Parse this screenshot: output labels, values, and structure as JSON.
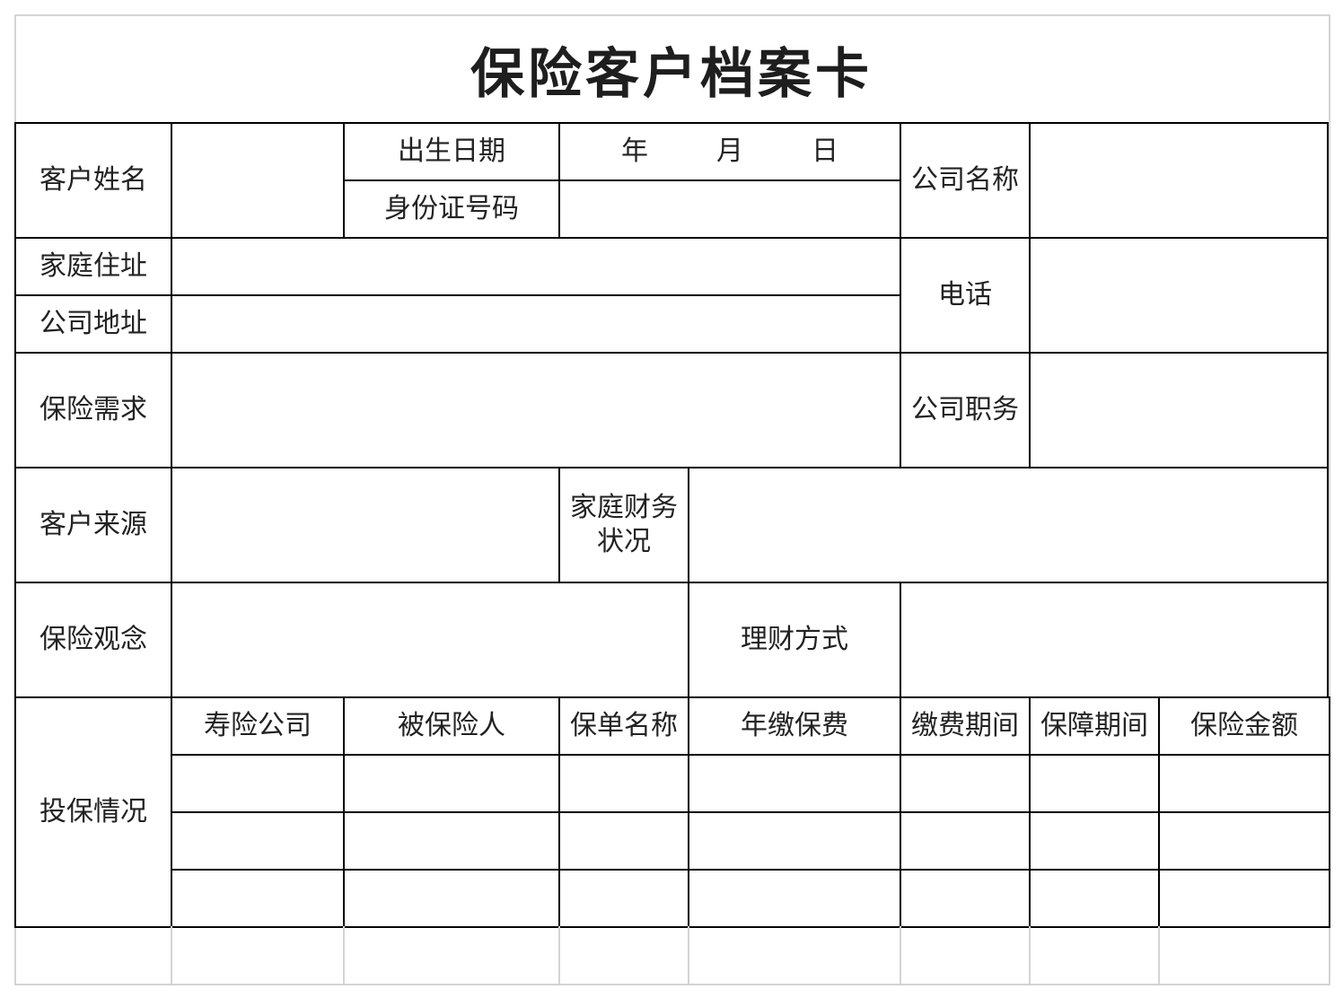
{
  "title": "保险客户档案卡",
  "labels": {
    "customer_name": "客户姓名",
    "birth_date": "出生日期",
    "id_number": "身份证号码",
    "company_name": "公司名称",
    "home_address": "家庭住址",
    "company_address": "公司地址",
    "phone": "电话",
    "insurance_needs": "保险需求",
    "company_position": "公司职务",
    "customer_source": "客户来源",
    "family_finance": "家庭财务状况",
    "insurance_concept": "保险观念",
    "financial_method": "理财方式",
    "policy_status": "投保情况"
  },
  "date_parts": {
    "year": "年",
    "month": "月",
    "day": "日"
  },
  "policy_table": {
    "headers": [
      "寿险公司",
      "被保险人",
      "保单名称",
      "年缴保费",
      "缴费期间",
      "保障期间",
      "保险金额"
    ],
    "rows": [
      [
        "",
        "",
        "",
        "",
        "",
        "",
        ""
      ],
      [
        "",
        "",
        "",
        "",
        "",
        "",
        ""
      ],
      [
        "",
        "",
        "",
        "",
        "",
        "",
        ""
      ]
    ]
  },
  "values": {
    "customer_name": "",
    "birth_year": "",
    "birth_month": "",
    "birth_day": "",
    "id_number": "",
    "company_name": "",
    "home_address": "",
    "company_address": "",
    "phone": "",
    "insurance_needs": "",
    "company_position": "",
    "customer_source": "",
    "family_finance": "",
    "insurance_concept": "",
    "financial_method": ""
  }
}
